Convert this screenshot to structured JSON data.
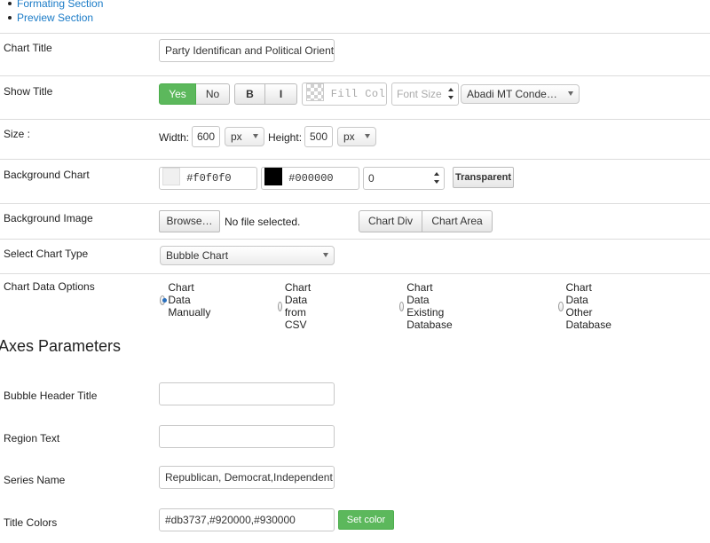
{
  "nav_links": [
    "Formating Section",
    "Preview Section"
  ],
  "chart_title": {
    "label": "Chart Title",
    "value": "Party Identifican and Political Orient"
  },
  "show_title": {
    "label": "Show Title",
    "yes": "Yes",
    "no": "No",
    "bold": "B",
    "italic": "I",
    "fill_placeholder": "Fill Colo",
    "font_size_placeholder": "Font Size",
    "font_family": "Abadi MT Conde…"
  },
  "size": {
    "label": "Size :",
    "width_label": "Width:",
    "width_value": "600",
    "width_unit": "px",
    "height_label": "Height:",
    "height_value": "500",
    "height_unit": "px"
  },
  "background_chart": {
    "label": "Background Chart",
    "color1": "#f0f0f0",
    "color2": "#000000",
    "opacity": "0",
    "transparent_label": "Transparent"
  },
  "background_image": {
    "label": "Background Image",
    "browse_label": "Browse…",
    "file_status": "No file selected.",
    "chart_div_label": "Chart Div",
    "chart_area_label": "Chart Area"
  },
  "chart_type": {
    "label": "Select Chart Type",
    "value": "Bubble Chart"
  },
  "chart_data_options": {
    "label": "Chart Data Options",
    "options": [
      "Chart Data Manually",
      "Chart Data from CSV",
      "Chart Data Existing Database",
      "Chart Data Other Database"
    ],
    "selected": 0
  },
  "axes_heading": "Axes Parameters",
  "bubble_header": {
    "label": "Bubble Header Title",
    "value": ""
  },
  "region_text": {
    "label": "Region Text",
    "value": ""
  },
  "series_name": {
    "label": "Series Name",
    "value": "Republican, Democrat,Independent"
  },
  "title_colors": {
    "label": "Title Colors",
    "value": "#db3737,#920000,#930000",
    "set_color_label": "Set color"
  },
  "colors": {
    "link": "#1a7bc7",
    "yes_active": "#5cb85c",
    "set_color": "#5cb85c",
    "swatch_light": "#f0f0f0",
    "swatch_dark": "#000000"
  }
}
